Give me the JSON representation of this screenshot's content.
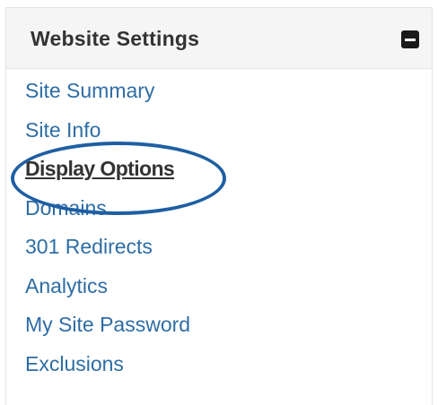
{
  "panel": {
    "title": "Website Settings",
    "collapse_icon": "minus-square-icon"
  },
  "nav": {
    "items": [
      {
        "label": "Site Summary"
      },
      {
        "label": "Site Info"
      },
      {
        "label": "Display Options",
        "active": true
      },
      {
        "label": "Domains"
      },
      {
        "label": "301 Redirects"
      },
      {
        "label": "Analytics"
      },
      {
        "label": "My Site Password"
      },
      {
        "label": "Exclusions"
      }
    ]
  },
  "colors": {
    "link": "#2e6da4",
    "active_link": "#333333",
    "header_bg": "#f5f5f5",
    "annotation": "#1f5fa3"
  }
}
